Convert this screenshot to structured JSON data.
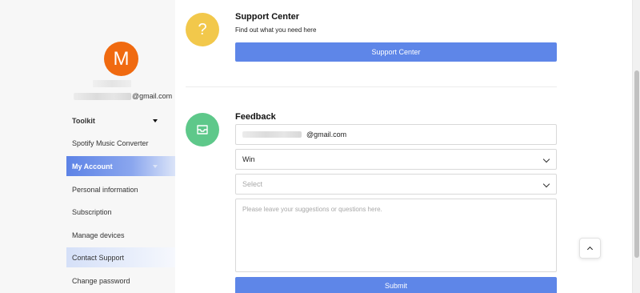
{
  "profile": {
    "avatar_letter": "M",
    "email_domain": "@gmail.com",
    "avatar_color": "#f06a10"
  },
  "sidebar": {
    "items": [
      {
        "label": "Toolkit",
        "has_caret": true
      },
      {
        "label": "Spotify Music Converter"
      },
      {
        "label": "My Account",
        "active": true,
        "has_caret": true
      },
      {
        "label": "Personal information"
      },
      {
        "label": "Subscription"
      },
      {
        "label": "Manage devices"
      },
      {
        "label": "Contact Support",
        "hover": true
      },
      {
        "label": "Change password"
      }
    ]
  },
  "support": {
    "title": "Support Center",
    "subtitle": "Find out what you need here",
    "button_label": "Support Center",
    "icon": "question-mark-icon",
    "icon_glyph": "?",
    "icon_color": "#f2c84b"
  },
  "feedback": {
    "title": "Feedback",
    "icon": "inbox-icon",
    "icon_color": "#5ec88a",
    "email_domain": "@gmail.com",
    "platform_value": "Win",
    "category_placeholder": "Select",
    "message_placeholder": "Please leave your suggestions or questions here.",
    "submit_label": "Submit"
  },
  "accent_color": "#5e86e8"
}
